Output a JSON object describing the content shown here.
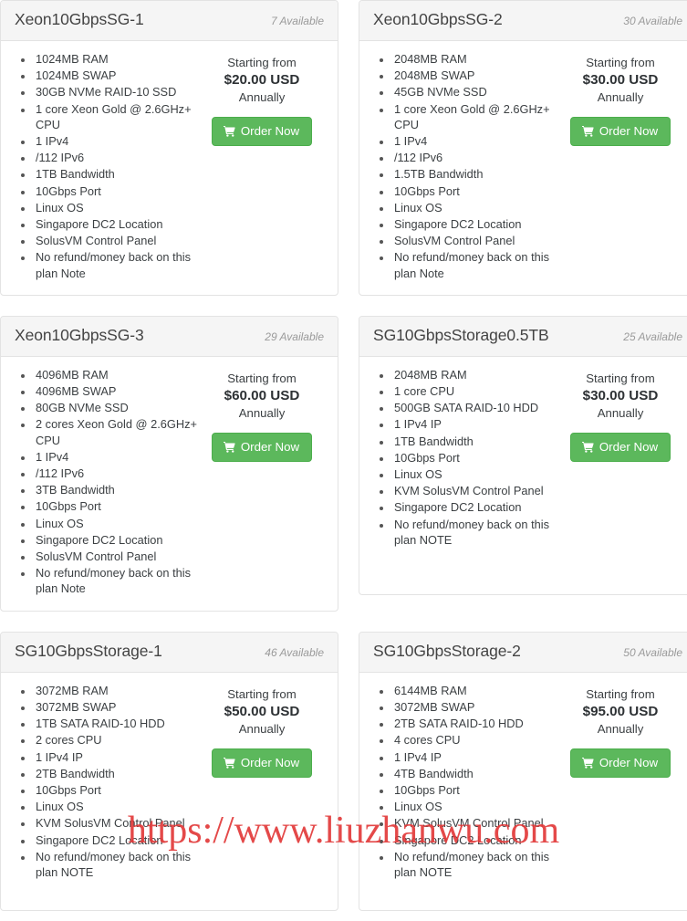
{
  "page": {
    "watermark": "https://www.liuzhanwu.com",
    "accent_green": "#5cb85c",
    "watermark_color": "#e23a3a",
    "header_bg": "#f5f5f5",
    "card_border": "#e3e3e3"
  },
  "labels": {
    "starting_from": "Starting from",
    "billing_cycle": "Annually",
    "order_now": "Order Now",
    "cart_icon": "shopping-cart-icon"
  },
  "plans": [
    {
      "name": "Xeon10GbpsSG-1",
      "availability": "7 Available",
      "price": "$20.00 USD",
      "starting_from": "Starting from",
      "cycle": "Annually",
      "order_label": "Order Now",
      "features": [
        "1024MB RAM",
        "1024MB SWAP",
        "30GB NVMe RAID-10 SSD",
        "1 core Xeon Gold @ 2.6GHz+ CPU",
        "1 IPv4",
        "/112 IPv6",
        "1TB Bandwidth",
        "10Gbps Port",
        "Linux OS",
        "Singapore DC2 Location",
        "SolusVM Control Panel",
        "No refund/money back on this plan Note"
      ]
    },
    {
      "name": "Xeon10GbpsSG-2",
      "availability": "30 Available",
      "price": "$30.00 USD",
      "starting_from": "Starting from",
      "cycle": "Annually",
      "order_label": "Order Now",
      "features": [
        "2048MB RAM",
        "2048MB SWAP",
        "45GB NVMe SSD",
        "1 core Xeon Gold @ 2.6GHz+ CPU",
        "1 IPv4",
        "/112 IPv6",
        "1.5TB Bandwidth",
        "10Gbps Port",
        "Linux OS",
        "Singapore DC2 Location",
        "SolusVM Control Panel",
        "No refund/money back on this plan Note"
      ]
    },
    {
      "name": "Xeon10GbpsSG-3",
      "availability": "29 Available",
      "price": "$60.00 USD",
      "starting_from": "Starting from",
      "cycle": "Annually",
      "order_label": "Order Now",
      "features": [
        "4096MB RAM",
        "4096MB SWAP",
        "80GB NVMe SSD",
        "2 cores Xeon Gold @ 2.6GHz+ CPU",
        "1 IPv4",
        "/112 IPv6",
        "3TB Bandwidth",
        "10Gbps Port",
        "Linux OS",
        "Singapore DC2 Location",
        "SolusVM Control Panel",
        "No refund/money back on this plan Note"
      ]
    },
    {
      "name": "SG10GbpsStorage0.5TB",
      "availability": "25 Available",
      "price": "$30.00 USD",
      "starting_from": "Starting from",
      "cycle": "Annually",
      "order_label": "Order Now",
      "features": [
        "2048MB RAM",
        "1 core CPU",
        "500GB SATA RAID-10 HDD",
        "1 IPv4 IP",
        "1TB Bandwidth",
        "10Gbps Port",
        "Linux OS",
        "KVM SolusVM Control Panel",
        "Singapore DC2 Location",
        "No refund/money back on this plan NOTE"
      ]
    },
    {
      "name": "SG10GbpsStorage-1",
      "availability": "46 Available",
      "price": "$50.00 USD",
      "starting_from": "Starting from",
      "cycle": "Annually",
      "order_label": "Order Now",
      "features": [
        "3072MB RAM",
        "3072MB SWAP",
        "1TB SATA RAID-10 HDD",
        "2 cores CPU",
        "1 IPv4 IP",
        "2TB Bandwidth",
        "10Gbps Port",
        "Linux OS",
        "KVM SolusVM Control Panel",
        "Singapore DC2 Location",
        "No refund/money back on this plan NOTE"
      ]
    },
    {
      "name": "SG10GbpsStorage-2",
      "availability": "50 Available",
      "price": "$95.00 USD",
      "starting_from": "Starting from",
      "cycle": "Annually",
      "order_label": "Order Now",
      "features": [
        "6144MB RAM",
        "3072MB SWAP",
        "2TB SATA RAID-10 HDD",
        "4 cores CPU",
        "1 IPv4 IP",
        "4TB Bandwidth",
        "10Gbps Port",
        "Linux OS",
        "KVM SolusVM Control Panel",
        "Singapore DC2 Location",
        "No refund/money back on this plan NOTE"
      ]
    }
  ]
}
